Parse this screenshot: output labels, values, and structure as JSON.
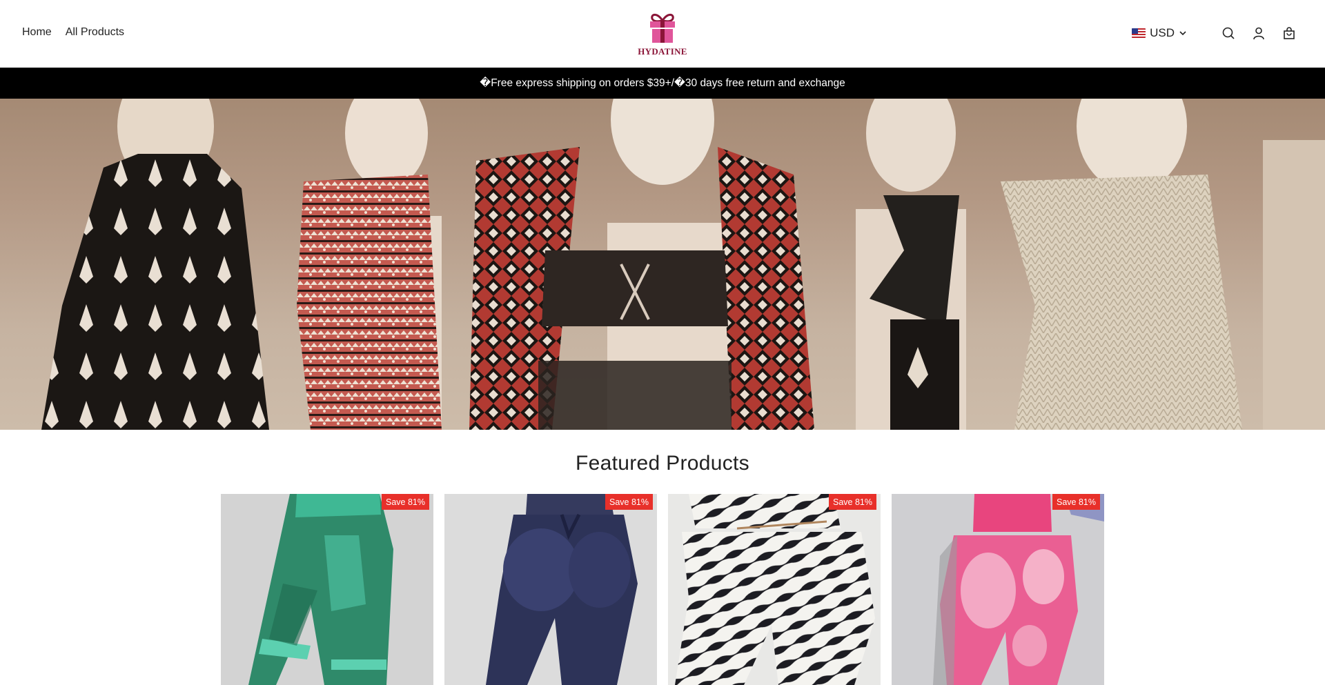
{
  "header": {
    "nav": [
      {
        "label": "Home"
      },
      {
        "label": "All Products"
      }
    ],
    "logo_text": "HYDATINE",
    "currency": "USD",
    "icons": [
      "flag-us-icon",
      "chevron-down-icon",
      "search-icon",
      "account-icon",
      "cart-icon"
    ]
  },
  "announcement": {
    "text": "�Free express shipping on orders $39+/�30 days free return and exchange"
  },
  "featured": {
    "title": "Featured Products",
    "products": [
      {
        "badge": "Save 81%"
      },
      {
        "badge": "Save 81%"
      },
      {
        "badge": "Save 81%"
      },
      {
        "badge": "Save 81%"
      }
    ]
  },
  "colors": {
    "announcement_bg": "#000000",
    "badge_bg": "#e8302a",
    "logo_pink": "#e0559a",
    "logo_text": "#8b1538"
  }
}
